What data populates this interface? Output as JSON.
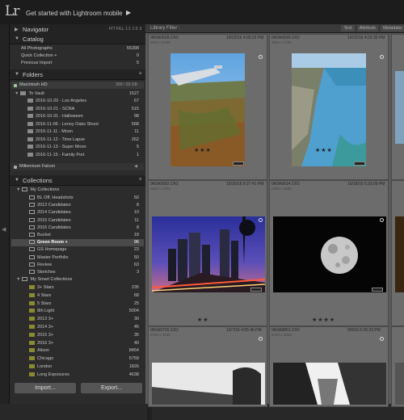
{
  "app": {
    "logo": "Lr",
    "identity_plate": "Get started with Lightroom mobile",
    "identity_arrow": "▶"
  },
  "navigator": {
    "title": "Navigator",
    "zoom_options": "FIT FILL 1:1 1:3 ⇕"
  },
  "catalog": {
    "title": "Catalog",
    "items": [
      {
        "label": "All Photographs",
        "count": "55398"
      },
      {
        "label": "Quick Collection +",
        "count": "0"
      },
      {
        "label": "Previous Import",
        "count": "5"
      }
    ]
  },
  "folders": {
    "title": "Folders",
    "add": "+",
    "volume": {
      "name": "Macintosh HD",
      "space": "999 / 93 GB"
    },
    "root": {
      "label": "To Vault",
      "count": "1527"
    },
    "items": [
      {
        "label": "2016-10-20 - Los Angeles",
        "count": "67"
      },
      {
        "label": "2016-10-21 - SCNA",
        "count": "515"
      },
      {
        "label": "2016-10-31 - Halloween",
        "count": "98"
      },
      {
        "label": "2016-11-06 - Lenoy Oaks Shoot",
        "count": "568"
      },
      {
        "label": "2016-11-11 - Moon",
        "count": "11"
      },
      {
        "label": "2016-11-12 - Time Lapse",
        "count": "262"
      },
      {
        "label": "2016-11-13 - Super Moon",
        "count": "5"
      },
      {
        "label": "2016-11-15 - Family Port",
        "count": "1"
      }
    ],
    "volume2": {
      "name": "Millennium Falcon",
      "indicator": "◀"
    }
  },
  "collections": {
    "title": "Collections",
    "add": "+",
    "set1": {
      "label": "My Collections"
    },
    "items": [
      {
        "label": "BL Off. Headshots",
        "count": "50"
      },
      {
        "label": "2013 Candidates",
        "count": "8"
      },
      {
        "label": "2014 Candidates",
        "count": "10"
      },
      {
        "label": "2015 Candidates",
        "count": "11"
      },
      {
        "label": "2016 Candidates",
        "count": "8"
      },
      {
        "label": "Bucket",
        "count": "18"
      },
      {
        "label": "Green Room +",
        "count": "96"
      },
      {
        "label": "GS Homepage",
        "count": "23"
      },
      {
        "label": "Master Portfolio",
        "count": "50"
      },
      {
        "label": "Review",
        "count": "63"
      },
      {
        "label": "Sketches",
        "count": "3"
      }
    ],
    "set2": {
      "label": "My Smart Collections"
    },
    "smart_items": [
      {
        "label": "3+ Stars",
        "count": "235"
      },
      {
        "label": "4 Stars",
        "count": "68"
      },
      {
        "label": "5 Stars",
        "count": "25"
      },
      {
        "label": "8th Light",
        "count": "5004"
      },
      {
        "label": "2013 3+",
        "count": "30"
      },
      {
        "label": "2014 3+",
        "count": "45"
      },
      {
        "label": "2015 3+",
        "count": "35"
      },
      {
        "label": "2016 3+",
        "count": "40"
      },
      {
        "label": "Alison",
        "count": "8454"
      },
      {
        "label": "Chicago",
        "count": "5759"
      },
      {
        "label": "London",
        "count": "1826"
      },
      {
        "label": "Long Exposures",
        "count": "4638"
      }
    ]
  },
  "buttons": {
    "import": "Import...",
    "export": "Export..."
  },
  "library_filter": {
    "label": "Library Filter :",
    "options": [
      "Text",
      "Attribute",
      "Metadata"
    ]
  },
  "thumbnails": [
    {
      "index": "",
      "filename": "0K6A0608.CR2",
      "date": "10/22/16 4:05:02 PM",
      "dims": "3840 x 5760",
      "stars": "★★★"
    },
    {
      "index": "",
      "filename": "0K6A0599.CR2",
      "date": "10/22/16 4:03:35 PM",
      "dims": "3840 x 5760",
      "stars": "★★★"
    },
    {
      "index": "",
      "filename": "0K6A9992.CR2",
      "date": "10/20/16 8:27:41 PM",
      "dims": "3632 x 3752",
      "stars": "★★"
    },
    {
      "index": "",
      "filename": "0K6A9914.CR2",
      "date": "10/18/16 5:33:09 PM",
      "dims": "2400 x 3600",
      "stars": "★★★★"
    },
    {
      "index": "",
      "filename": "0K6A9705.CR2",
      "date": "10/7/16 4:05:46 PM",
      "dims": "5760 x 3840",
      "stars": ""
    },
    {
      "index": "",
      "filename": "0K6A8852.CR2",
      "date": "9/9/16 6:25:33 PM",
      "dims": "5470 x 3658",
      "stars": ""
    }
  ],
  "colors": {
    "panel": "#2c2c2c",
    "grid": "#5a5a5a",
    "cell": "#6c6c6c",
    "selected_row": "#4a4a4a"
  }
}
